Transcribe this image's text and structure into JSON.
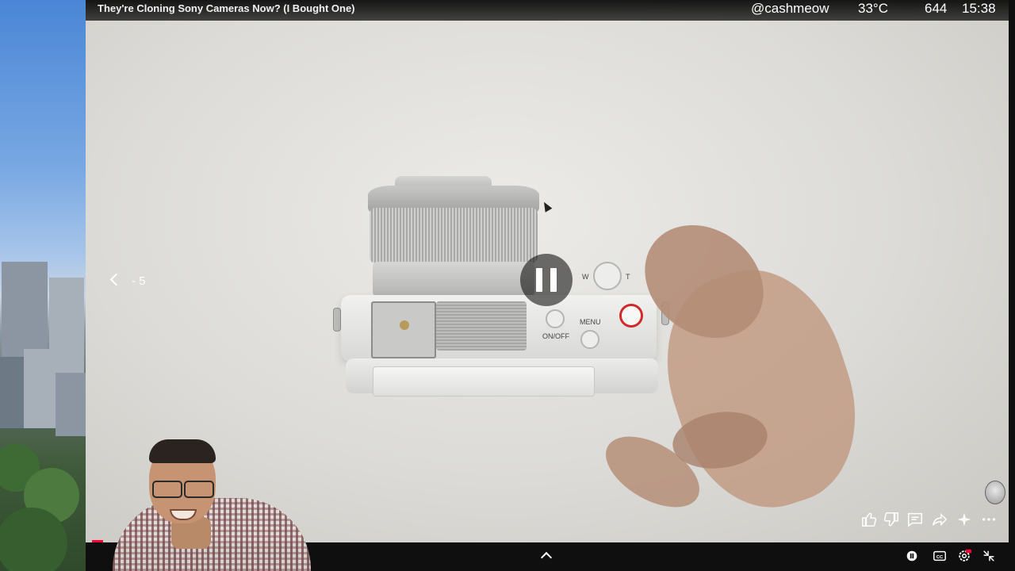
{
  "video": {
    "title": "They're Cloning Sony Cameras Now? (I Bought One)"
  },
  "status": {
    "handle": "@cashmeow",
    "temperature": "33°C",
    "count": "644",
    "time": "15:38"
  },
  "seek": {
    "text": "‑ 5"
  },
  "camera_labels": {
    "on_off": "ON/OFF",
    "menu": "MENU",
    "zoom_w": "W",
    "zoom_t": "T"
  },
  "actions": {
    "icons": [
      "like-icon",
      "dislike-icon",
      "comments-icon",
      "share-icon",
      "remix-icon",
      "more-icon"
    ]
  },
  "controls": {
    "icons": [
      "chevron-up-icon",
      "pause-small-icon",
      "captions-icon",
      "settings-icon",
      "exit-fullscreen-icon"
    ]
  },
  "colors": {
    "accent": "#ff0033",
    "overlay": "#0f0f0f"
  }
}
